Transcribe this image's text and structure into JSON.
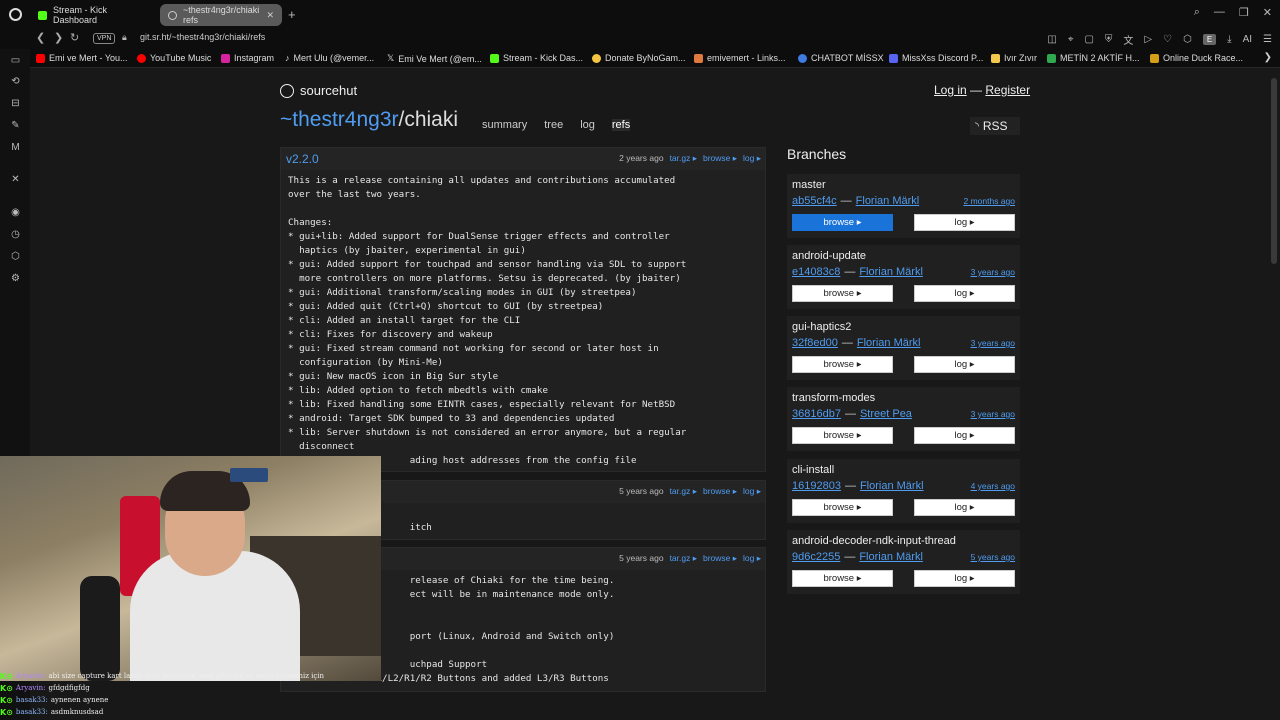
{
  "browser": {
    "tabs": [
      {
        "label": "Stream - Kick Dashboard",
        "color": "#53fc18"
      },
      {
        "label": "~thestr4ng3r/chiaki refs",
        "color": "#cccccc"
      }
    ],
    "vpn_label": "VPN",
    "url": "git.sr.ht/~thestr4ng3r/chiaki/refs",
    "ext_badge": "E",
    "ai_label": "AI"
  },
  "bookmarks": [
    {
      "label": "Emi ve Mert - You...",
      "color": "#ff0000"
    },
    {
      "label": "YouTube Music",
      "color": "#ff0000"
    },
    {
      "label": "Instagram",
      "color": "#d6249f"
    },
    {
      "label": "Mert Ulu (@vemer...",
      "color": "#ffffff"
    },
    {
      "label": "Emi Ve Mert (@em...",
      "color": "#ffffff"
    },
    {
      "label": "Stream - Kick Das...",
      "color": "#53fc18"
    },
    {
      "label": "Donate ByNoGam...",
      "color": "#f5c542"
    },
    {
      "label": "emivemert - Links...",
      "color": "#e07a3f"
    },
    {
      "label": "CHATBOT MİSSX",
      "color": "#3f7be0"
    },
    {
      "label": "MissXss Discord P...",
      "color": "#5865f2"
    },
    {
      "label": "Ivır Zıvır",
      "color": "#f2c94c"
    },
    {
      "label": "METİN 2 AKTİF H...",
      "color": "#2fa84f"
    },
    {
      "label": "Online Duck Race...",
      "color": "#d4a017"
    }
  ],
  "site": {
    "brand": "sourcehut",
    "login": "Log in",
    "sep": "—",
    "register": "Register",
    "owner": "~thestr4ng3r",
    "repo_name": "/chiaki",
    "tabs": [
      "summary",
      "tree",
      "log",
      "refs"
    ],
    "rss": "RSS"
  },
  "releases": [
    {
      "tag": "v2.2.0",
      "age": "2 years ago",
      "links": [
        "tar.gz ▸",
        "browse ▸",
        "log ▸"
      ],
      "body": "This is a release containing all updates and contributions accumulated\nover the last two years.\n\nChanges:\n* gui+lib: Added support for DualSense trigger effects and controller\n  haptics (by jbaiter, experimental in gui)\n* gui: Added support for touchpad and sensor handling via SDL to support\n  more controllers on more platforms. Setsu is deprecated. (by jbaiter)\n* gui: Additional transform/scaling modes in GUI (by streetpea)\n* gui: Added quit (Ctrl+Q) shortcut to GUI (by streetpea)\n* cli: Added an install target for the CLI\n* cli: Fixes for discovery and wakeup\n* gui: Fixed stream command not working for second or later host in\n  configuration (by Mini-Me)\n* gui: New macOS icon in Big Sur style\n* lib: Added option to fetch mbedtls with cmake\n* lib: Fixed handling some EINTR cases, especially relevant for NetBSD\n* android: Target SDK bumped to 33 and dependencies updated\n* lib: Server shutdown is not considered an error anymore, but a regular\n  disconnect\n                      ading host addresses from the config file"
    },
    {
      "tag": "",
      "age": "5 years ago",
      "links": [
        "tar.gz ▸",
        "browse ▸",
        "log ▸"
      ],
      "body": "\n                      itch"
    },
    {
      "tag": "",
      "age": "5 years ago",
      "links": [
        "tar.gz ▸",
        "browse ▸",
        "log ▸"
      ],
      "body": "                      release of Chiaki for the time being.\n                      ect will be in maintenance mode only.\n\n\n                      port (Linux, Android and Switch only)\n\n                      uchpad Support\n* Android: New L1/L2/R1/R2 Buttons and added L3/R3 Buttons"
    }
  ],
  "branches": {
    "title": "Branches",
    "browse_label": "browse ▸",
    "log_label": "log ▸",
    "sep": "—",
    "items": [
      {
        "name": "master",
        "hash": "ab55cf4c",
        "author": "Florian Märkl",
        "age": "2 months ago",
        "primary": true
      },
      {
        "name": "android-update",
        "hash": "e14083c8",
        "author": "Florian Märkl",
        "age": "3 years ago",
        "primary": false
      },
      {
        "name": "gui-haptics2",
        "hash": "32f8ed00",
        "author": "Florian Märkl",
        "age": "3 years ago",
        "primary": false
      },
      {
        "name": "transform-modes",
        "hash": "36816db7",
        "author": "Street Pea",
        "age": "3 years ago",
        "primary": false
      },
      {
        "name": "cli-install",
        "hash": "16192803",
        "author": "Florian Märkl",
        "age": "4 years ago",
        "primary": false
      },
      {
        "name": "android-decoder-ndk-input-thread",
        "hash": "9d6c2255",
        "author": "Florian Märkl",
        "age": "5 years ago",
        "primary": false
      }
    ]
  },
  "chat": [
    {
      "name": "Aryavin:",
      "msg": "abi size capture kart lazım diye biliyorum ama görüntü vs aktarabilmeniz için"
    },
    {
      "name": "Aryavin:",
      "msg": "gfdgdfigfdg"
    },
    {
      "name": "basak33:",
      "msg": "aynenen aynene"
    },
    {
      "name": "basak33:",
      "msg": "asdmknusdsad"
    }
  ]
}
